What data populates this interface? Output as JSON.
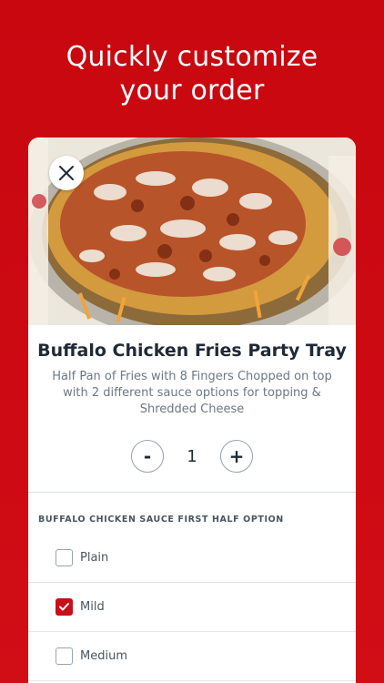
{
  "headline": {
    "line1": "Quickly customize",
    "line2": "your order"
  },
  "close": {
    "icon": "close-icon"
  },
  "item": {
    "title": "Buffalo Chicken Fries Party Tray",
    "description": "Half Pan of Fries with 8 Fingers Chopped on top with 2 different sauce options for topping & Shredded Cheese"
  },
  "quantity": {
    "minus_label": "-",
    "value": "1",
    "plus_label": "+"
  },
  "sauce_section": {
    "title": "BUFFALO CHICKEN SAUCE FIRST HALF OPTION",
    "options": [
      {
        "label": "Plain",
        "checked": false
      },
      {
        "label": "Mild",
        "checked": true
      },
      {
        "label": "Medium",
        "checked": false
      }
    ]
  },
  "colors": {
    "brand_red": "#c8070f",
    "check_red": "#c8101a",
    "text_dark": "#1f2a36",
    "text_muted": "#6d7782"
  }
}
